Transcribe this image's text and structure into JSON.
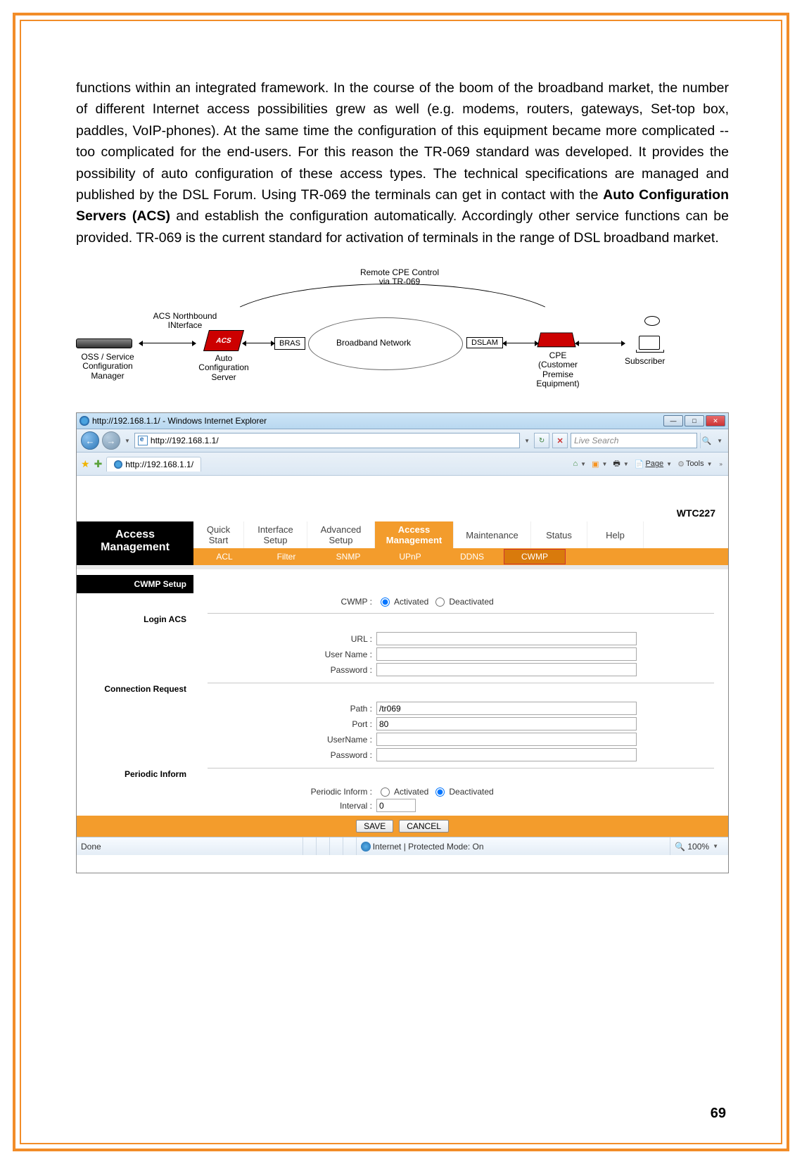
{
  "bodyText": "functions within an integrated framework. In the course of the boom of the broadband market, the number of different Internet access possibilities grew as well (e.g. modems, routers, gateways, Set-top box, paddles, VoIP-phones). At the same time the configuration of this equipment became more complicated -- too complicated for the end-users. For this reason the TR-069 standard was developed. It provides the possibility of auto configuration of these access types. The technical specifications are managed and published by the DSL Forum. Using TR-069 the terminals can get in contact with the ",
  "bodyBold": "Auto Configuration Servers (ACS)",
  "bodyTextAfter": " and establish the configuration automatically. Accordingly other service functions can be provided. TR-069 is the current standard for activation of terminals in the range of DSL broadband market.",
  "diagram": {
    "title": "Remote CPE Control\nvia TR-069",
    "acsNorth": "ACS Northbound\nINterface",
    "oss": "OSS / Service\nConfiguration\nManager",
    "acs": "ACS",
    "autoConf": "Auto\nConfiguration\nServer",
    "bras": "BRAS",
    "broadband": "Broadband Network",
    "dslam": "DSLAM",
    "cpe": "CPE\n(Customer\nPremise\nEquipment)",
    "subscriber": "Subscriber"
  },
  "browser": {
    "title": "http://192.168.1.1/ - Windows Internet Explorer",
    "url": "http://192.168.1.1/",
    "search_placeholder": "Live Search",
    "tabTitle": "http://192.168.1.1/",
    "toolbar": {
      "page": "Page",
      "tools": "Tools"
    },
    "status_done": "Done",
    "status_zone": "Internet | Protected Mode: On",
    "zoom": "100%"
  },
  "router": {
    "model": "WTC227",
    "leftTitle": "Access\nManagement",
    "tabs": [
      "Quick\nStart",
      "Interface\nSetup",
      "Advanced\nSetup",
      "Access\nManagement",
      "Maintenance",
      "Status",
      "Help"
    ],
    "activeTab": 3,
    "subtabs": [
      "ACL",
      "Filter",
      "SNMP",
      "UPnP",
      "DDNS",
      "CWMP"
    ],
    "activeSub": 5,
    "sections": {
      "cwmpSetup": "CWMP Setup",
      "cwmpLabel": "CWMP :",
      "activated": "Activated",
      "deactivated": "Deactivated",
      "loginAcs": "Login ACS",
      "url": "URL :",
      "userName": "User Name :",
      "password": "Password :",
      "connReq": "Connection Request",
      "path": "Path :",
      "pathVal": "/tr069",
      "port": "Port :",
      "portVal": "80",
      "userName2": "UserName :",
      "password2": "Password :",
      "periodic": "Periodic Inform",
      "periodicInform": "Periodic Inform :",
      "interval": "Interval :",
      "intervalVal": "0"
    },
    "buttons": {
      "save": "SAVE",
      "cancel": "CANCEL"
    }
  },
  "pageNumber": "69"
}
